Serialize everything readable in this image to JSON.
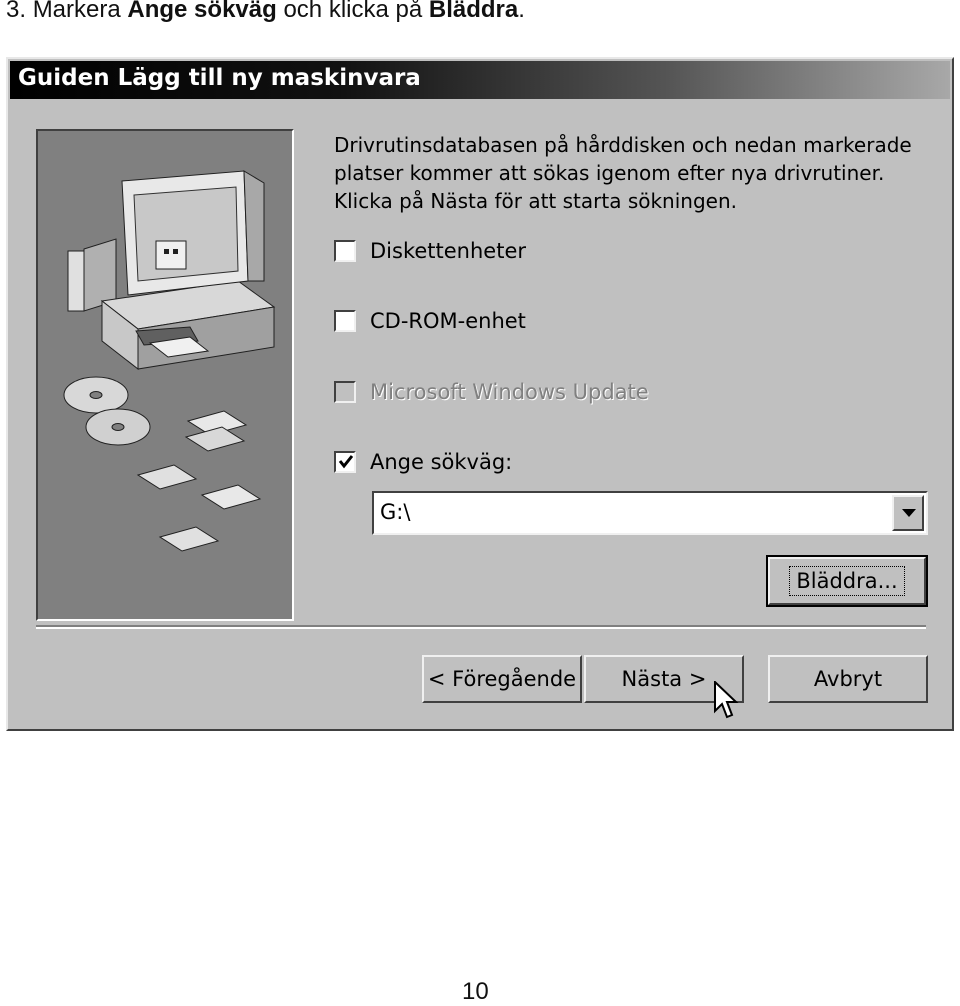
{
  "instruction": {
    "number": "3.",
    "prefix": "Markera",
    "field_name": "Ange sökväg",
    "middle": "och klicka på",
    "button_name": "Bläddra",
    "suffix": "."
  },
  "dialog": {
    "title": "Guiden Lägg till ny maskinvara",
    "description_lines": [
      "Drivrutinsdatabasen på hårddisken och nedan markerade",
      "platser kommer att sökas igenom efter nya drivrutiner.",
      "Klicka på Nästa för att starta sökningen."
    ],
    "checkboxes": [
      {
        "label": "Diskettenheter",
        "checked": false,
        "enabled": true
      },
      {
        "label": "CD-ROM-enhet",
        "checked": false,
        "enabled": true
      },
      {
        "label": "Microsoft Windows Update",
        "checked": false,
        "enabled": false
      },
      {
        "label": "Ange sökväg:",
        "checked": true,
        "enabled": true
      }
    ],
    "path_combo": {
      "value": "G:\\"
    },
    "browse_button": "Bläddra...",
    "back_button": "< Föregående",
    "next_button": "Nästa >",
    "cancel_button": "Avbryt"
  },
  "icons": {
    "side_panel": "computer-cd-floppy-illustration",
    "combo_arrow": "dropdown-arrow-icon",
    "cursor": "mouse-pointer-icon",
    "check": "checkmark-icon"
  },
  "colors": {
    "dialog_face": "#c0c0c0",
    "side_panel": "#808080",
    "title_gradient_start": "#000000",
    "title_gradient_end": "#a8a8a8"
  },
  "footer": {
    "page_number": "10"
  }
}
